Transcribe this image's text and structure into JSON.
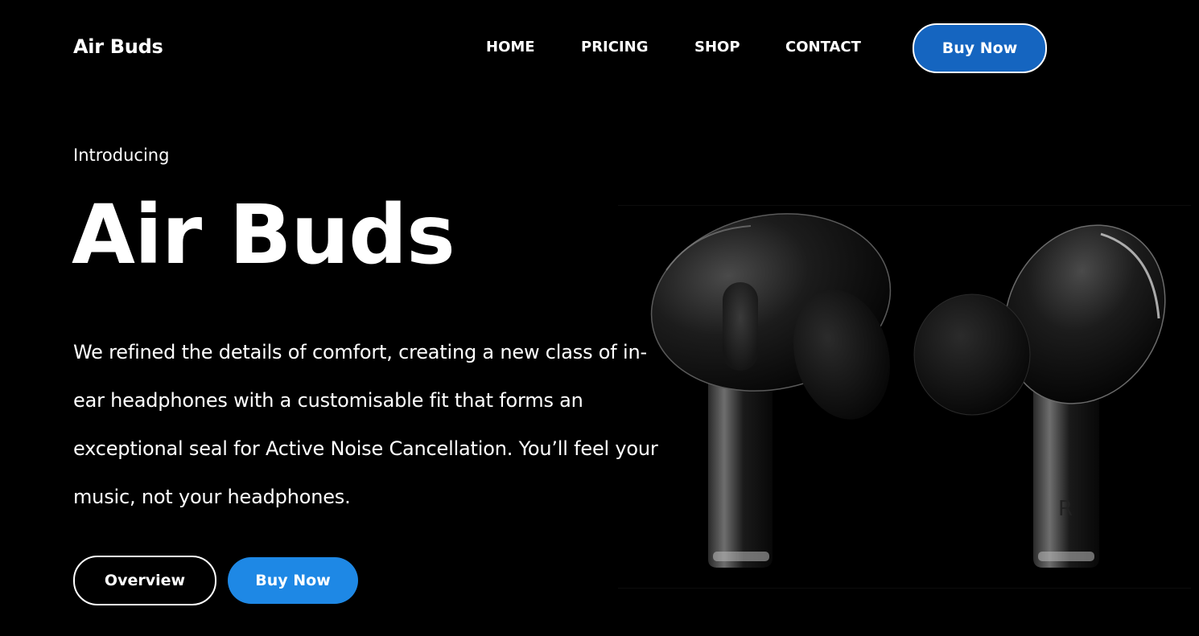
{
  "header": {
    "logo": "Air Buds",
    "nav": [
      {
        "label": "HOME"
      },
      {
        "label": "PRICING"
      },
      {
        "label": "SHOP"
      },
      {
        "label": "CONTACT"
      }
    ],
    "cta_label": "Buy Now"
  },
  "hero": {
    "eyebrow": "Introducing",
    "title": "Air Buds",
    "description": "We refined the details of comfort, creating a new class of in-ear headphones with a customisable fit that forms an exceptional seal for Active Noise Cancellation. You’ll feel your music, not your headphones.",
    "overview_label": "Overview",
    "buy_label": "Buy Now"
  },
  "product_image": {
    "earbud_marking": "R"
  },
  "colors": {
    "background": "#000000",
    "text": "#ffffff",
    "nav_button": "#1565c0",
    "primary_button": "#1e88e5"
  }
}
